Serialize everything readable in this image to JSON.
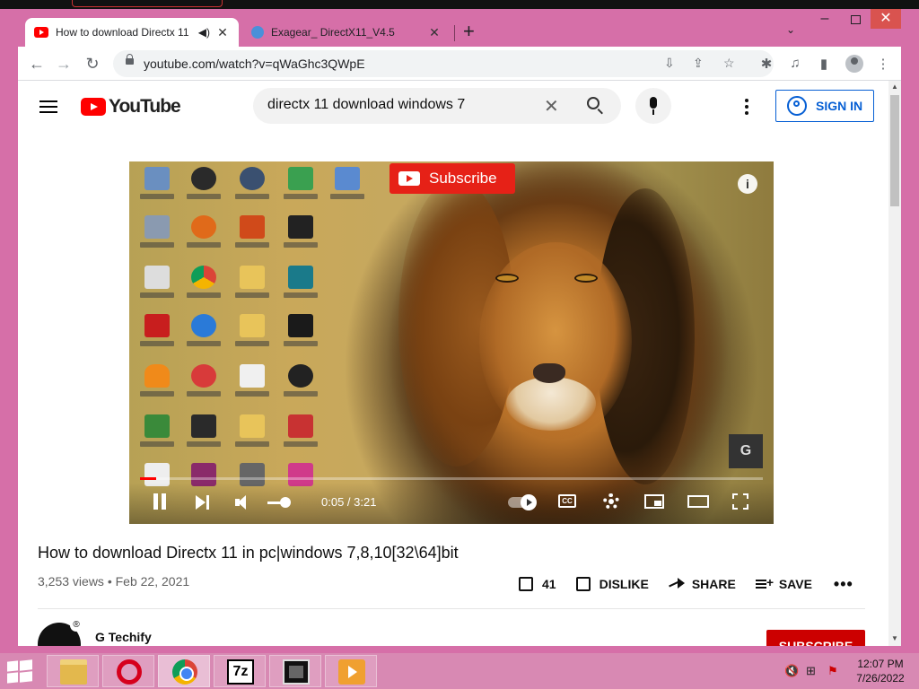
{
  "browser": {
    "tabs": [
      {
        "title": "How to download Directx 11",
        "favicon": "youtube-favicon",
        "audio": true,
        "active": true
      },
      {
        "title": "Exagear_ DirectX11_V4.5",
        "favicon": "exagear-favicon",
        "active": false
      }
    ],
    "new_tab_symbol": "+",
    "tab_search_symbol": "⌄",
    "window_controls": {
      "minimize": "–",
      "close": "✕"
    },
    "url": "youtube.com/watch?v=qWaGhc3QWpE",
    "nav": {
      "back": "←",
      "forward": "→",
      "reload": "↻"
    },
    "omnibox_icons": {
      "install": "⇩",
      "share": "⇪",
      "bookmark": "☆"
    },
    "toolbar_icons": {
      "extensions": "✱",
      "media": "♫",
      "sidepanel": "▮",
      "menu": "⋮"
    }
  },
  "youtube": {
    "logo_text": "YouTube",
    "search_query": "directx 11 download windows 7",
    "clear_symbol": "✕",
    "sign_in_label": "SIGN IN",
    "video": {
      "overlay_subscribe_label": "Subscribe",
      "info_symbol": "i",
      "watermark": "G",
      "current_time": "0:05",
      "duration": "3:21",
      "timecode": "0:05 / 3:21",
      "progress_fraction": 0.026,
      "volume_fraction": 0.6,
      "cc_label": "CC"
    },
    "title": "How to download Directx 11 in pc|windows 7,8,10[32\\64]bit",
    "views": "3,253 views",
    "separator": "•",
    "date": "Feb 22, 2021",
    "likes": "41",
    "dislike_label": "DISLIKE",
    "share_label": "SHARE",
    "save_label": "SAVE",
    "more_symbol": "•••",
    "channel": {
      "name": "G Techify",
      "subscribe_label": "SUBSCRIBE"
    }
  },
  "taskbar": {
    "apps": [
      "file-explorer",
      "opera",
      "chrome",
      "7-zip",
      "video-editor",
      "media-player"
    ],
    "sevenzip_label": "7z",
    "tray": {
      "volume": "🔇",
      "network": "⊞",
      "flag": "⚑"
    },
    "time": "12:07 PM",
    "date": "7/26/2022"
  },
  "colors": {
    "window_frame": "#d66fa8",
    "yt_red": "#ff0000",
    "link_blue": "#065fd4",
    "subscribe_red": "#cc0000"
  }
}
